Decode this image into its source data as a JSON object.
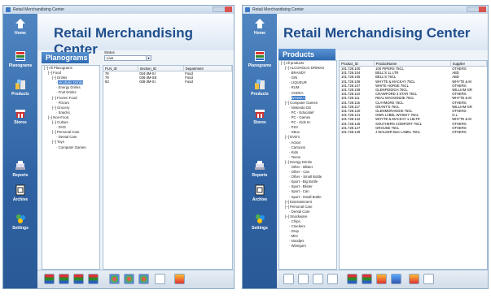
{
  "left_window": {
    "title": "Retail Merchandising Center",
    "app_title": "Retail Merchandising Center",
    "nav": [
      "Home",
      "Planograms",
      "Products",
      "Stores",
      "Reports",
      "Archive",
      "Settings"
    ],
    "panel_title": "Planograms",
    "status_label": "Status",
    "status_value": "Live",
    "tree": [
      {
        "t": "All Planograms",
        "d": 0,
        "p": "−"
      },
      {
        "t": "Food",
        "d": 1,
        "p": "−"
      },
      {
        "t": "Drinks",
        "d": 2,
        "p": "−"
      },
      {
        "t": "Alcoholic Drinks",
        "d": 3,
        "p": "",
        "sel": true
      },
      {
        "t": "Energy Drinks",
        "d": 3,
        "p": ""
      },
      {
        "t": "Fruit Drinks",
        "d": 3,
        "p": ""
      },
      {
        "t": "Frozen Food",
        "d": 2,
        "p": "−"
      },
      {
        "t": "Pizza's",
        "d": 3,
        "p": ""
      },
      {
        "t": "Grocery",
        "d": 2,
        "p": "−"
      },
      {
        "t": "Snacks",
        "d": 3,
        "p": ""
      },
      {
        "t": "Non-Food",
        "d": 1,
        "p": "−"
      },
      {
        "t": "Culture",
        "d": 2,
        "p": "−"
      },
      {
        "t": "DVD",
        "d": 3,
        "p": ""
      },
      {
        "t": "Personal Care",
        "d": 2,
        "p": "−"
      },
      {
        "t": "Dental Care",
        "d": 3,
        "p": ""
      },
      {
        "t": "Toys",
        "d": 2,
        "p": "−"
      },
      {
        "t": "Computer Games",
        "d": 3,
        "p": ""
      }
    ],
    "columns": [
      "PLN_ID",
      "Section_ID",
      "Department"
    ],
    "rows": [
      [
        "76",
        "034-3M-SI",
        "Food"
      ],
      [
        "79",
        "036-3M-SE",
        "Food"
      ],
      [
        "83",
        "036-3M-SI",
        "Food"
      ]
    ]
  },
  "right_window": {
    "title": "Retail Merchandising Center",
    "app_title": "Retail Merchandising Center",
    "nav": [
      "Home",
      "Planograms",
      "Products",
      "Stores",
      "Reports",
      "Archive",
      "Settings"
    ],
    "panel_title": "Products",
    "tree": [
      {
        "t": "All products",
        "d": 0,
        "p": "−"
      },
      {
        "t": "ALCOHOLIC DRINKS",
        "d": 1,
        "p": "−"
      },
      {
        "t": "BRANDY",
        "d": 2,
        "p": ""
      },
      {
        "t": "GIN",
        "d": 2,
        "p": ""
      },
      {
        "t": "LIQUEUR",
        "d": 2,
        "p": ""
      },
      {
        "t": "RUM",
        "d": 2,
        "p": ""
      },
      {
        "t": "VODKA",
        "d": 2,
        "p": ""
      },
      {
        "t": "WHISKY",
        "d": 2,
        "p": "",
        "sel": true
      },
      {
        "t": "Computer Games",
        "d": 1,
        "p": "−"
      },
      {
        "t": "Nintendo DS",
        "d": 2,
        "p": ""
      },
      {
        "t": "PC - Educatief",
        "d": 2,
        "p": ""
      },
      {
        "t": "PC - Games",
        "d": 2,
        "p": ""
      },
      {
        "t": "PC - Kids 5+",
        "d": 2,
        "p": ""
      },
      {
        "t": "PS3",
        "d": 2,
        "p": ""
      },
      {
        "t": "XBox",
        "d": 2,
        "p": ""
      },
      {
        "t": "DVD's",
        "d": 1,
        "p": "−"
      },
      {
        "t": "Action",
        "d": 2,
        "p": ""
      },
      {
        "t": "Cartoons",
        "d": 2,
        "p": ""
      },
      {
        "t": "Kids",
        "d": 2,
        "p": ""
      },
      {
        "t": "Teens",
        "d": 2,
        "p": ""
      },
      {
        "t": "Energy Drinks",
        "d": 1,
        "p": "−"
      },
      {
        "t": "Other - Blister",
        "d": 2,
        "p": ""
      },
      {
        "t": "Other - Can",
        "d": 2,
        "p": ""
      },
      {
        "t": "Other - Small Bottle",
        "d": 2,
        "p": ""
      },
      {
        "t": "Sport - Big Bottle",
        "d": 2,
        "p": ""
      },
      {
        "t": "Sport - Blister",
        "d": 2,
        "p": ""
      },
      {
        "t": "Sport - Can",
        "d": 2,
        "p": ""
      },
      {
        "t": "Sport - Small Bottle",
        "d": 2,
        "p": ""
      },
      {
        "t": "Entertainment",
        "d": 1,
        "p": "+"
      },
      {
        "t": "Personal Care",
        "d": 1,
        "p": "−"
      },
      {
        "t": "Dental Care",
        "d": 2,
        "p": ""
      },
      {
        "t": "Snackware",
        "d": 1,
        "p": "−"
      },
      {
        "t": "Chips",
        "d": 2,
        "p": ""
      },
      {
        "t": "Crackers",
        "d": 2,
        "p": ""
      },
      {
        "t": "Drop",
        "d": 2,
        "p": ""
      },
      {
        "t": "Mint",
        "d": 2,
        "p": ""
      },
      {
        "t": "Noodjes",
        "d": 2,
        "p": ""
      },
      {
        "t": "Winegum",
        "d": 2,
        "p": ""
      }
    ],
    "columns": [
      "Product_ID",
      "ProductName",
      "Supplier"
    ],
    "rows": [
      [
        "101.728.100",
        "100 PIPERS 75CL",
        "OTHERS"
      ],
      [
        "101.728.104",
        "BELL'S 1L LTR",
        "ABD"
      ],
      [
        "101.728.105",
        "BELL'S 75CL",
        "ABD"
      ],
      [
        "101.728.106",
        "WHYTE & MACKAY 75CL",
        "WHYTE & M"
      ],
      [
        "101.728.107",
        "WHITE HORSE 75CL",
        "OTHERS"
      ],
      [
        "101.728.108",
        "GLENFIDDICH 75CL",
        "WILLIAM GR"
      ],
      [
        "101.728.110",
        "CRAWFORD 3 STAR 75CL",
        "OTHERS"
      ],
      [
        "101.728.111",
        "REAL MACKENZIE 75CL",
        "WHYTE & M"
      ],
      [
        "101.728.115",
        "CLAYMORE 75CL",
        "OTHERS"
      ],
      [
        "101.728.117",
        "GRANT'S 75CL",
        "WILLIAM GR"
      ],
      [
        "101.728.120",
        "GLENMORANGIE 75CL",
        "OTHERS"
      ],
      [
        "101.728.121",
        "OWN LABEL WHISKY 75CL",
        "O.L"
      ],
      [
        "101.728.122",
        "WHYTE & MACKAY 1.15LTR",
        "WHYTE & M"
      ],
      [
        "101.728.125",
        "SOUTHERN COMFORT 75CL",
        "OTHERS"
      ],
      [
        "101.728.127",
        "GROUSE 75CL",
        "OTHERS"
      ],
      [
        "101.728.128",
        "J WALKER BLK LABEL 75CL",
        "OTHERS"
      ]
    ]
  }
}
